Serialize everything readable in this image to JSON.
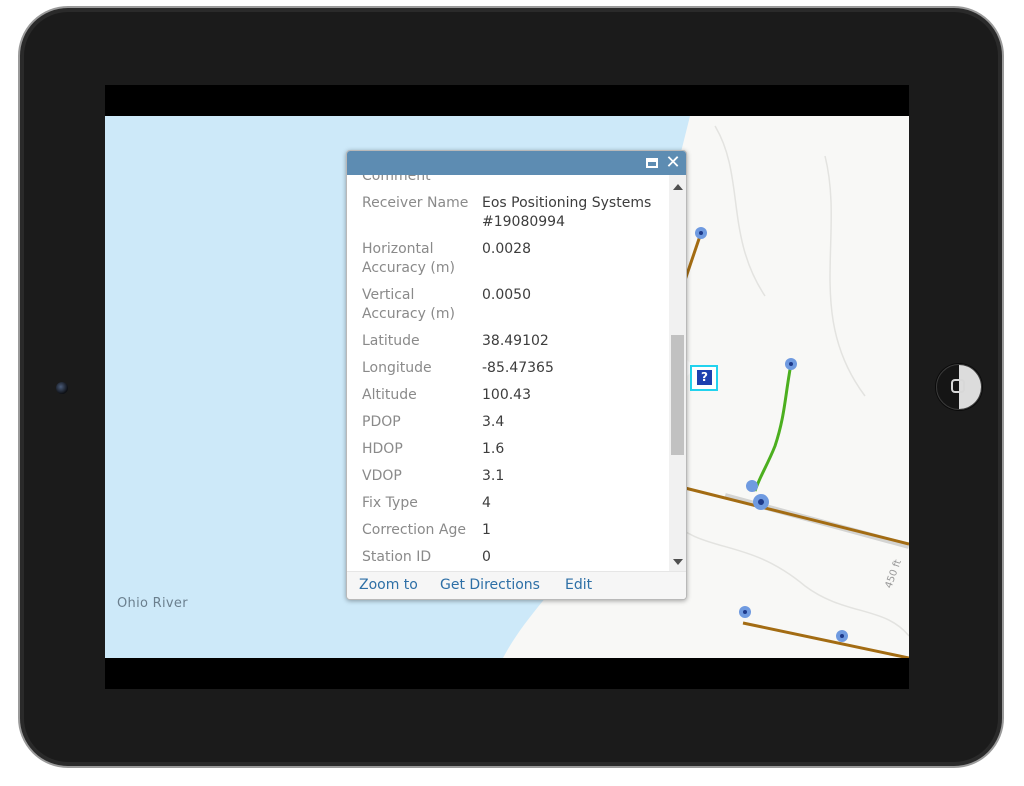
{
  "map": {
    "river_label": "Ohio River",
    "scale_label": "450 ft"
  },
  "popup": {
    "fields": [
      {
        "label": "Comment",
        "value": ""
      },
      {
        "label": "Receiver Name",
        "value": "Eos Positioning Systems #19080994"
      },
      {
        "label": "Horizontal Accuracy (m)",
        "value": "0.0028"
      },
      {
        "label": "Vertical Accuracy (m)",
        "value": "0.0050"
      },
      {
        "label": "Latitude",
        "value": "38.49102"
      },
      {
        "label": "Longitude",
        "value": "-85.47365"
      },
      {
        "label": "Altitude",
        "value": "100.43"
      },
      {
        "label": "PDOP",
        "value": "3.4"
      },
      {
        "label": "HDOP",
        "value": "1.6"
      },
      {
        "label": "VDOP",
        "value": "3.1"
      },
      {
        "label": "Fix Type",
        "value": "4"
      },
      {
        "label": "Correction Age",
        "value": "1"
      },
      {
        "label": "Station ID",
        "value": "0"
      }
    ],
    "actions": {
      "zoom_to": "Zoom to",
      "get_directions": "Get Directions",
      "edit": "Edit"
    }
  },
  "colors": {
    "water": "#cde9f9",
    "land": "#f8f8f6",
    "header": "#5d8cb2",
    "link": "#2d6fa6",
    "line_brown": "#a36c13",
    "line_green": "#4caf1f",
    "point_blue": "#6f9ae0"
  },
  "icons": {
    "maximize": "maximize-icon",
    "close": "close-icon",
    "feature": "question-mark-icon"
  }
}
